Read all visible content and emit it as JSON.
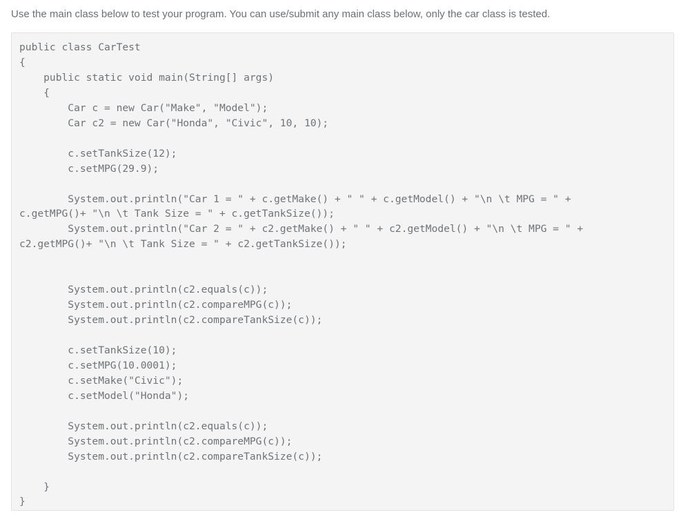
{
  "instruction": {
    "text": "Use the main class below to test your program. You can use/submit any main class below, only the car class is tested."
  },
  "code_panel": {
    "language": "java",
    "background_color": "#f4f4f4",
    "border_color": "#e2e2e2",
    "text_color": "#6d7378",
    "lines": [
      "public class CarTest",
      "{",
      "    public static void main(String[] args)",
      "    {",
      "        Car c = new Car(\"Make\", \"Model\");",
      "        Car c2 = new Car(\"Honda\", \"Civic\", 10, 10);",
      "",
      "        c.setTankSize(12);",
      "        c.setMPG(29.9);",
      "",
      "        System.out.println(\"Car 1 = \" + c.getMake() + \" \" + c.getModel() + \"\\n \\t MPG = \" +",
      "c.getMPG()+ \"\\n \\t Tank Size = \" + c.getTankSize());",
      "        System.out.println(\"Car 2 = \" + c2.getMake() + \" \" + c2.getModel() + \"\\n \\t MPG = \" +",
      "c2.getMPG()+ \"\\n \\t Tank Size = \" + c2.getTankSize());",
      "",
      "",
      "        System.out.println(c2.equals(c));",
      "        System.out.println(c2.compareMPG(c));",
      "        System.out.println(c2.compareTankSize(c));",
      "",
      "        c.setTankSize(10);",
      "        c.setMPG(10.0001);",
      "        c.setMake(\"Civic\");",
      "        c.setModel(\"Honda\");",
      "",
      "        System.out.println(c2.equals(c));",
      "        System.out.println(c2.compareMPG(c));",
      "        System.out.println(c2.compareTankSize(c));",
      "",
      "    }",
      "}"
    ]
  }
}
